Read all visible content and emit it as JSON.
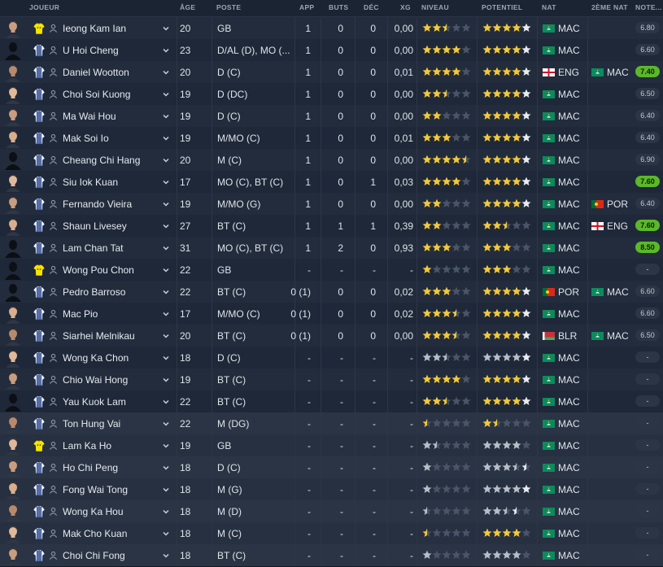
{
  "columns": {
    "joueur": "JOUEUR",
    "age": "ÂGE",
    "poste": "POSTE",
    "app": "APP",
    "buts": "BUTS",
    "dec": "DÉC",
    "xg": "XG",
    "niveau": "NIVEAU",
    "potentiel": "POTENTIEL",
    "nat": "NAT",
    "nat2": "2ÈME NAT",
    "note": "NOTE..."
  },
  "colors": {
    "star_full": "#f3c83a",
    "star_white": "#e8ecf1",
    "star_empty": "#4a5568",
    "note_green": "#5bb82a",
    "macao_green": "#0b8a5f"
  },
  "players": [
    {
      "name": "Ieong Kam Ian",
      "age": "20",
      "pos": "GB",
      "app": "1",
      "buts": "0",
      "dec": "0",
      "xg": "0,00",
      "niveau": 2.5,
      "potentiel": 5,
      "nat": "MAC",
      "nat2": "",
      "note": "6.80",
      "note_hi": false,
      "kit": "yellow",
      "dev": false
    },
    {
      "name": "U Hoi Cheng",
      "age": "23",
      "pos": "D/AL (D), MO (...",
      "app": "1",
      "buts": "0",
      "dec": "0",
      "xg": "0,00",
      "niveau": 4,
      "potentiel": 5,
      "nat": "MAC",
      "nat2": "",
      "note": "6.60",
      "note_hi": false,
      "kit": "stripe",
      "dev": false
    },
    {
      "name": "Daniel Wootton",
      "age": "20",
      "pos": "D (C)",
      "app": "1",
      "buts": "0",
      "dec": "0",
      "xg": "0,01",
      "niveau": 4,
      "potentiel": 5,
      "nat": "ENG",
      "nat2": "MAC",
      "note": "7.40",
      "note_hi": true,
      "kit": "stripe",
      "dev": false
    },
    {
      "name": "Choi Soi Kuong",
      "age": "19",
      "pos": "D (DC)",
      "app": "1",
      "buts": "0",
      "dec": "0",
      "xg": "0,00",
      "niveau": 2.5,
      "potentiel": 5,
      "nat": "MAC",
      "nat2": "",
      "note": "6.50",
      "note_hi": false,
      "kit": "stripe",
      "dev": false
    },
    {
      "name": "Ma Wai Hou",
      "age": "19",
      "pos": "D (C)",
      "app": "1",
      "buts": "0",
      "dec": "0",
      "xg": "0,00",
      "niveau": 2,
      "potentiel": 5,
      "nat": "MAC",
      "nat2": "",
      "note": "6.40",
      "note_hi": false,
      "kit": "stripe",
      "dev": false
    },
    {
      "name": "Mak Soi Io",
      "age": "19",
      "pos": "M/MO (C)",
      "app": "1",
      "buts": "0",
      "dec": "0",
      "xg": "0,01",
      "niveau": 3,
      "potentiel": 5,
      "nat": "MAC",
      "nat2": "",
      "note": "6.40",
      "note_hi": false,
      "kit": "stripe",
      "dev": false
    },
    {
      "name": "Cheang Chi Hang",
      "age": "20",
      "pos": "M (C)",
      "app": "1",
      "buts": "0",
      "dec": "0",
      "xg": "0,00",
      "niveau": 4.5,
      "potentiel": 5,
      "nat": "MAC",
      "nat2": "",
      "note": "6.90",
      "note_hi": false,
      "kit": "stripe",
      "dev": false
    },
    {
      "name": "Siu Iok Kuan",
      "age": "17",
      "pos": "MO (C), BT (C)",
      "app": "1",
      "buts": "0",
      "dec": "1",
      "xg": "0,03",
      "niveau": 4,
      "potentiel": 5,
      "nat": "MAC",
      "nat2": "",
      "note": "7.60",
      "note_hi": true,
      "kit": "stripe",
      "dev": false
    },
    {
      "name": "Fernando Vieira",
      "age": "19",
      "pos": "M/MO (G)",
      "app": "1",
      "buts": "0",
      "dec": "0",
      "xg": "0,00",
      "niveau": 2,
      "potentiel": 5,
      "nat": "MAC",
      "nat2": "POR",
      "note": "6.40",
      "note_hi": false,
      "kit": "stripe",
      "dev": false
    },
    {
      "name": "Shaun Livesey",
      "age": "27",
      "pos": "BT (C)",
      "app": "1",
      "buts": "1",
      "dec": "1",
      "xg": "0,39",
      "niveau": 2,
      "potentiel": 2.5,
      "nat": "MAC",
      "nat2": "ENG",
      "note": "7.60",
      "note_hi": true,
      "kit": "stripe",
      "dev": false
    },
    {
      "name": "Lam Chan Tat",
      "age": "31",
      "pos": "MO (C), BT (C)",
      "app": "1",
      "buts": "2",
      "dec": "0",
      "xg": "0,93",
      "niveau": 3,
      "potentiel": 3,
      "nat": "MAC",
      "nat2": "",
      "note": "8.50",
      "note_hi": true,
      "kit": "stripe",
      "dev": false
    },
    {
      "name": "Wong Pou Chon",
      "age": "22",
      "pos": "GB",
      "app": "-",
      "buts": "-",
      "dec": "-",
      "xg": "-",
      "niveau": 1,
      "potentiel": 3,
      "nat": "MAC",
      "nat2": "",
      "note": "-",
      "note_hi": false,
      "kit": "yellow",
      "dev": false
    },
    {
      "name": "Pedro Barroso",
      "age": "22",
      "pos": "BT (C)",
      "app": "0 (1)",
      "buts": "0",
      "dec": "0",
      "xg": "0,02",
      "niveau": 3,
      "potentiel": 5,
      "nat": "POR",
      "nat2": "MAC",
      "note": "6.60",
      "note_hi": false,
      "kit": "stripe",
      "dev": false
    },
    {
      "name": "Mac Pio",
      "age": "17",
      "pos": "M/MO (C)",
      "app": "0 (1)",
      "buts": "0",
      "dec": "0",
      "xg": "0,02",
      "niveau": 3.5,
      "potentiel": 5,
      "nat": "MAC",
      "nat2": "",
      "note": "6.60",
      "note_hi": false,
      "kit": "stripe",
      "dev": false
    },
    {
      "name": "Siarhei Melnikau",
      "age": "20",
      "pos": "BT (C)",
      "app": "0 (1)",
      "buts": "0",
      "dec": "0",
      "xg": "0,00",
      "niveau": 3.5,
      "potentiel": 5,
      "nat": "BLR",
      "nat2": "MAC",
      "note": "6.50",
      "note_hi": false,
      "kit": "stripe",
      "dev": false
    },
    {
      "name": "Wong Ka Chon",
      "age": "18",
      "pos": "D (C)",
      "app": "-",
      "buts": "-",
      "dec": "-",
      "xg": "-",
      "niveau": 2.5,
      "potentiel": 5,
      "nat": "MAC",
      "nat2": "",
      "note": "-",
      "note_hi": false,
      "kit": "stripe",
      "dev": false,
      "grey": true
    },
    {
      "name": "Chio Wai Hong",
      "age": "19",
      "pos": "BT (C)",
      "app": "-",
      "buts": "-",
      "dec": "-",
      "xg": "-",
      "niveau": 4,
      "potentiel": 5,
      "nat": "MAC",
      "nat2": "",
      "note": "-",
      "note_hi": false,
      "kit": "stripe",
      "dev": false
    },
    {
      "name": "Yau Kuok Lam",
      "age": "22",
      "pos": "BT (C)",
      "app": "-",
      "buts": "-",
      "dec": "-",
      "xg": "-",
      "niveau": 2.5,
      "potentiel": 5,
      "nat": "MAC",
      "nat2": "",
      "note": "-",
      "note_hi": false,
      "kit": "stripe",
      "dev": false
    },
    {
      "name": "Ton Hung Vai",
      "age": "22",
      "pos": "M (DG)",
      "app": "-",
      "buts": "-",
      "dec": "-",
      "xg": "-",
      "niveau": 0.5,
      "potentiel": 1.5,
      "nat": "MAC",
      "nat2": "",
      "note": "-",
      "note_hi": false,
      "kit": "stripe",
      "dev": true
    },
    {
      "name": "Lam Ka Ho",
      "age": "19",
      "pos": "GB",
      "app": "-",
      "buts": "-",
      "dec": "-",
      "xg": "-",
      "niveau": 1.5,
      "potentiel": 4,
      "nat": "MAC",
      "nat2": "",
      "note": "-",
      "note_hi": false,
      "kit": "yellow",
      "dev": true,
      "grey": true
    },
    {
      "name": "Ho Chi Peng",
      "age": "18",
      "pos": "D (C)",
      "app": "-",
      "buts": "-",
      "dec": "-",
      "xg": "-",
      "niveau": 1,
      "potentiel": 3.5,
      "pot_white": 1,
      "nat": "MAC",
      "nat2": "",
      "note": "-",
      "note_hi": false,
      "kit": "stripe",
      "dev": true,
      "grey": true
    },
    {
      "name": "Fong Wai Tong",
      "age": "18",
      "pos": "M (G)",
      "app": "-",
      "buts": "-",
      "dec": "-",
      "xg": "-",
      "niveau": 1,
      "potentiel": 5,
      "nat": "MAC",
      "nat2": "",
      "note": "-",
      "note_hi": false,
      "kit": "stripe",
      "dev": true,
      "grey": true
    },
    {
      "name": "Wong Ka Hou",
      "age": "18",
      "pos": "M (D)",
      "app": "-",
      "buts": "-",
      "dec": "-",
      "xg": "-",
      "niveau": 0.5,
      "potentiel": 2.5,
      "pot_white": 1,
      "nat": "MAC",
      "nat2": "",
      "note": "-",
      "note_hi": false,
      "kit": "stripe",
      "dev": true,
      "grey": true
    },
    {
      "name": "Mak Cho Kuan",
      "age": "18",
      "pos": "M (C)",
      "app": "-",
      "buts": "-",
      "dec": "-",
      "xg": "-",
      "niveau": 0.5,
      "potentiel": 4,
      "nat": "MAC",
      "nat2": "",
      "note": "-",
      "note_hi": false,
      "kit": "stripe",
      "dev": true
    },
    {
      "name": "Choi Chi Fong",
      "age": "18",
      "pos": "BT (C)",
      "app": "-",
      "buts": "-",
      "dec": "-",
      "xg": "-",
      "niveau": 1,
      "potentiel": 4,
      "nat": "MAC",
      "nat2": "",
      "note": "-",
      "note_hi": false,
      "kit": "stripe",
      "dev": true,
      "grey": true
    }
  ]
}
